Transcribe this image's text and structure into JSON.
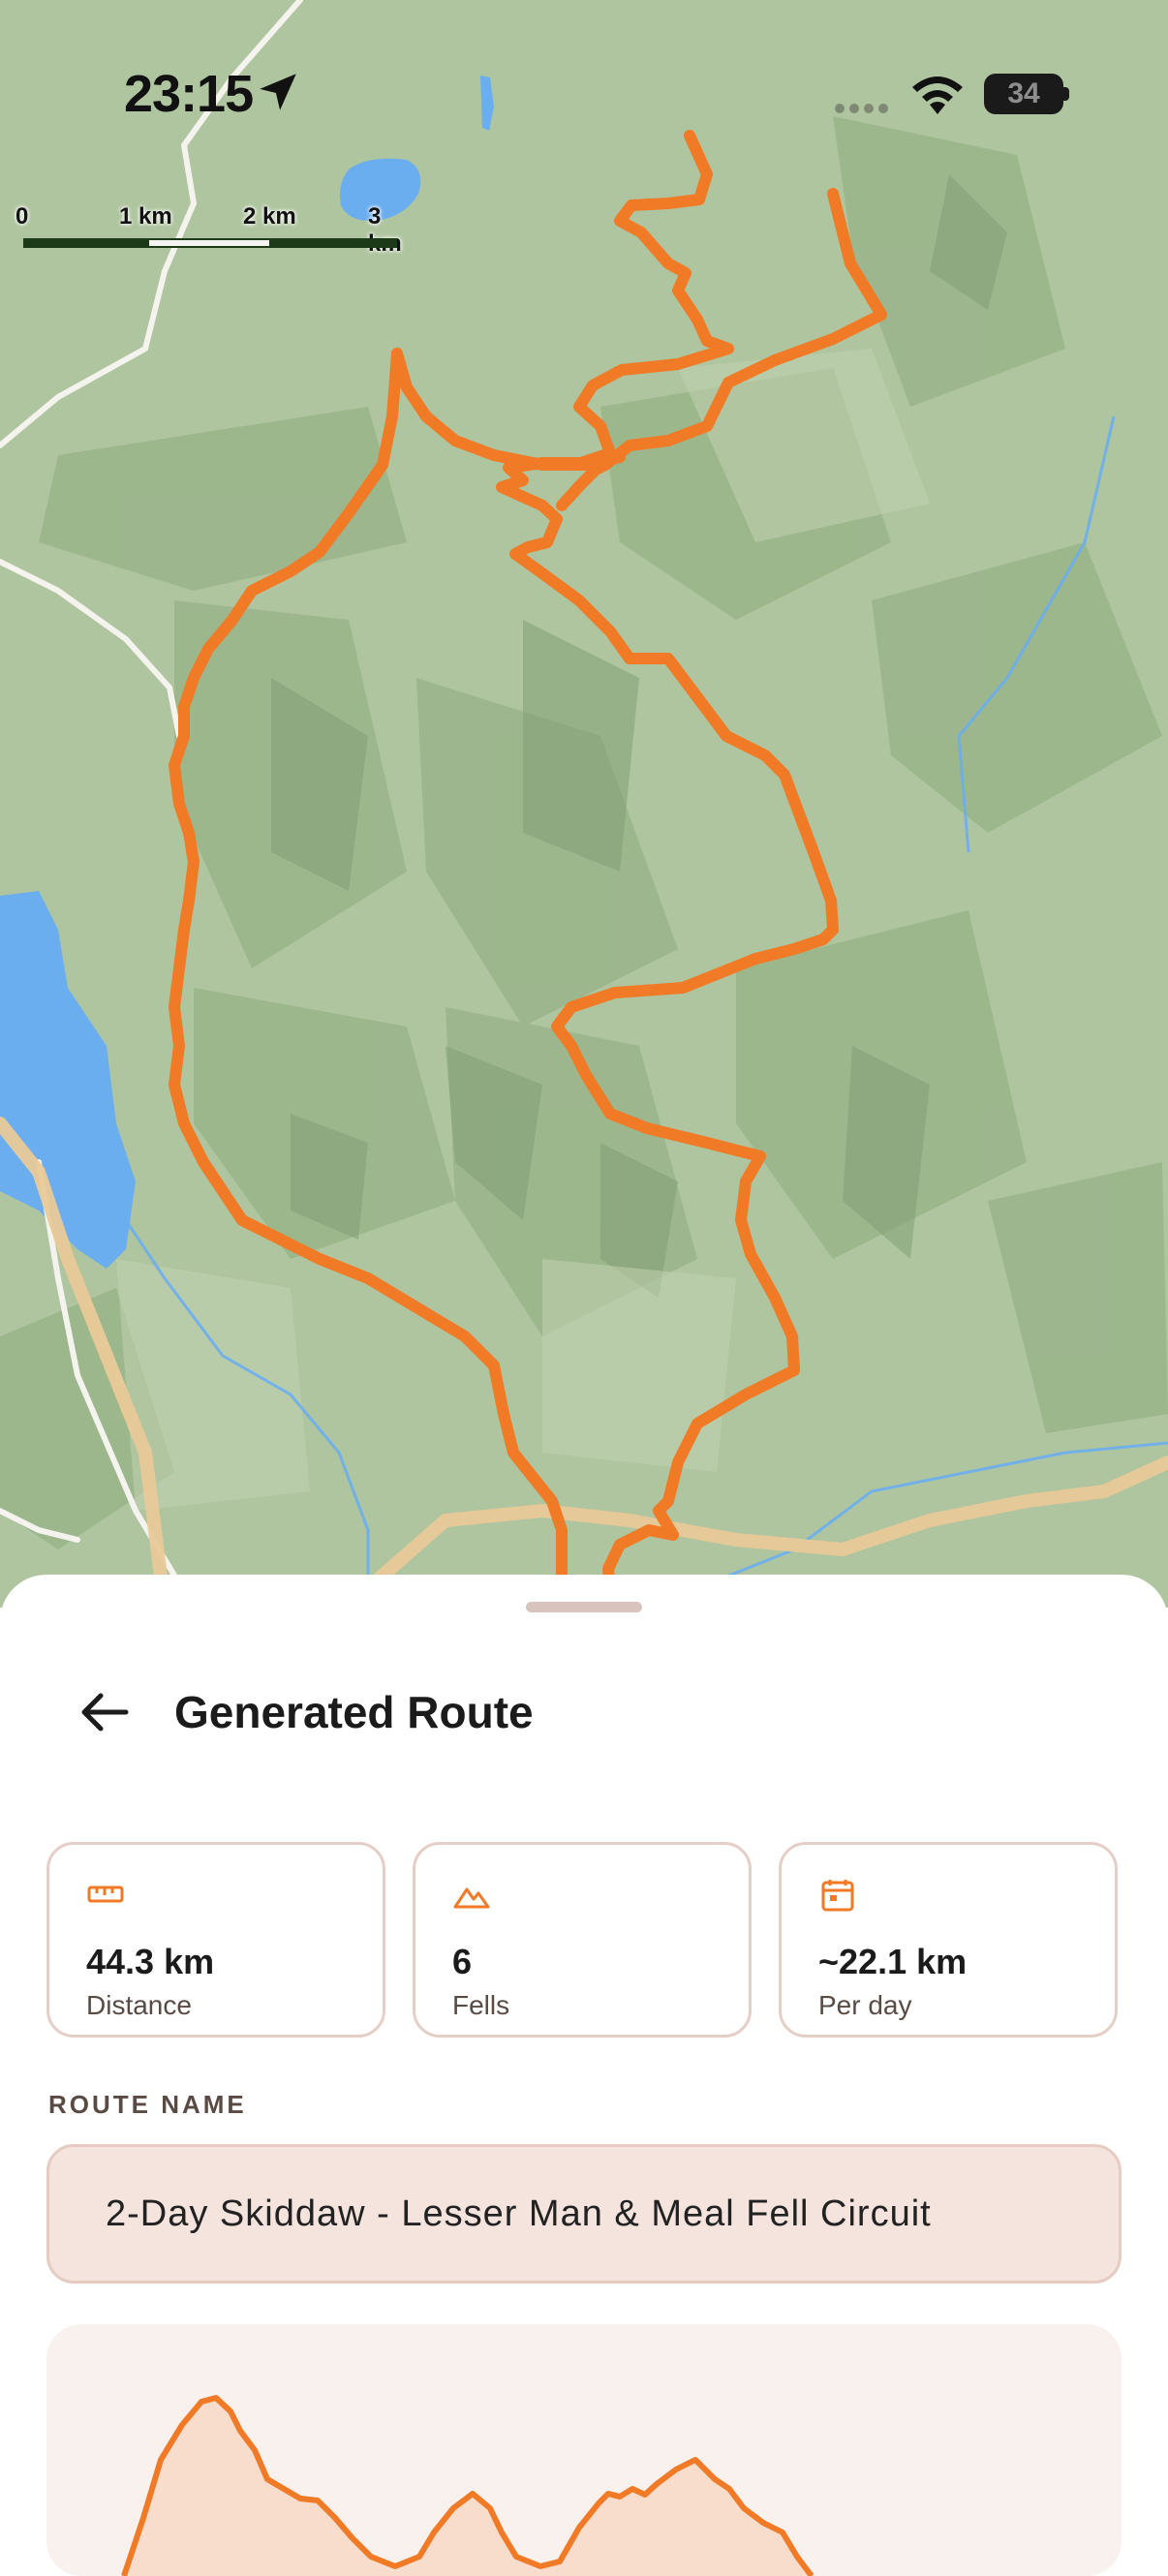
{
  "status_bar": {
    "time": "23:15",
    "battery": "34"
  },
  "map": {
    "scale_labels": [
      "0",
      "1 km",
      "2 km",
      "3 km"
    ],
    "route_color": "#f07a25",
    "water_color": "#6aaef0",
    "land_color": "#a9c29a"
  },
  "sheet": {
    "title": "Generated Route",
    "stats": [
      {
        "icon": "ruler-icon",
        "value": "44.3 km",
        "label": "Distance"
      },
      {
        "icon": "mountain-icon",
        "value": "6",
        "label": "Fells"
      },
      {
        "icon": "calendar-icon",
        "value": "~22.1 km",
        "label": "Per day"
      }
    ],
    "route_name_label": "ROUTE NAME",
    "route_name_value": "2-Day Skiddaw - Lesser Man & Meal Fell Circuit"
  },
  "colors": {
    "accent": "#f07a25",
    "card_border": "#e5cec6",
    "field_bg": "#f5e3dd"
  }
}
